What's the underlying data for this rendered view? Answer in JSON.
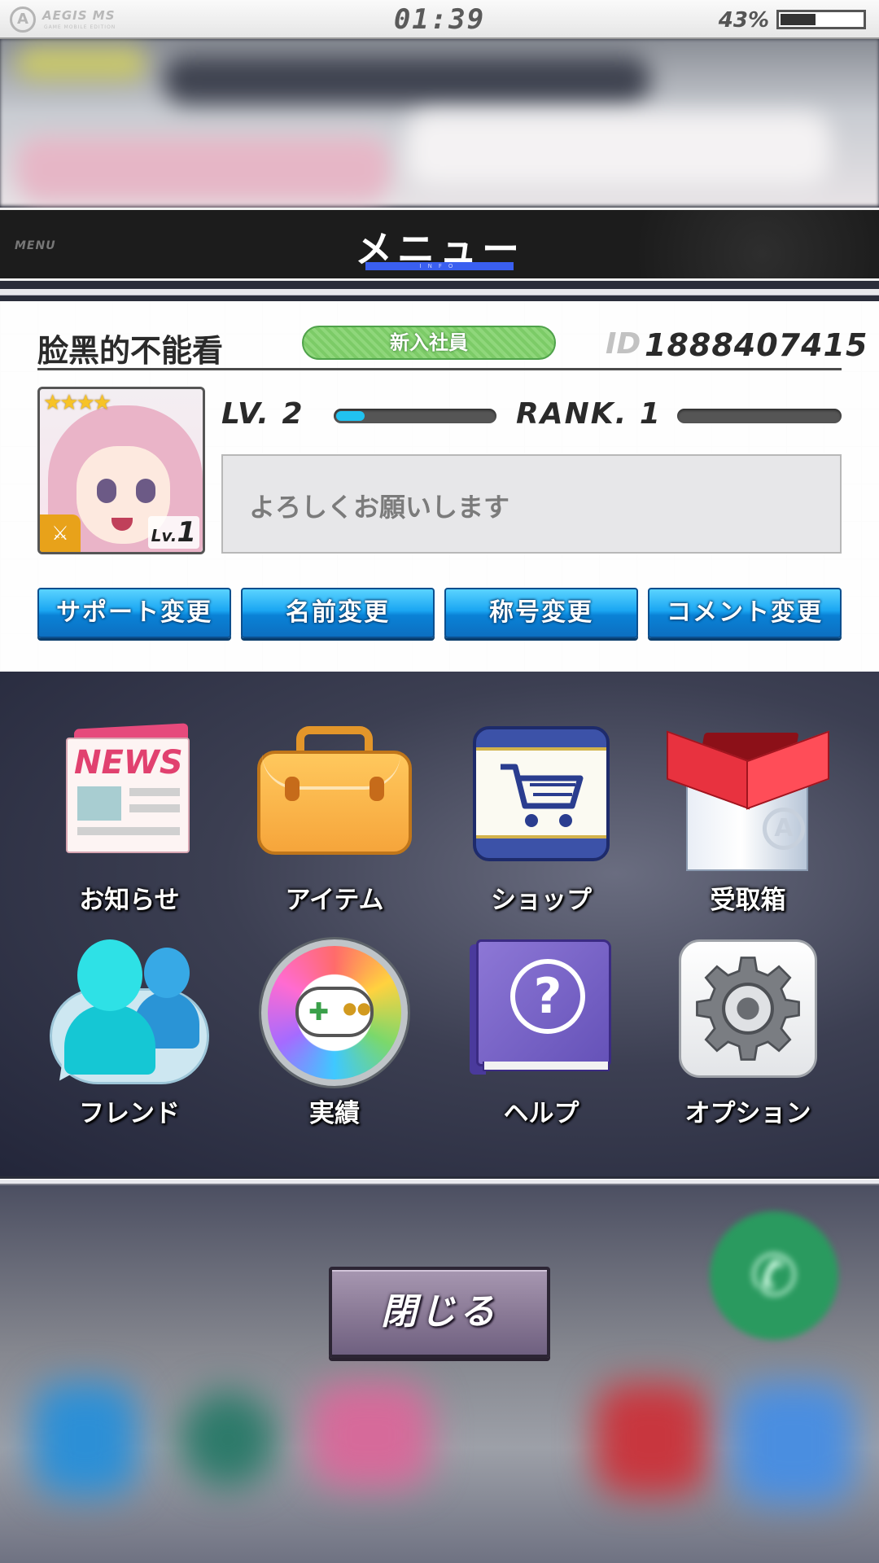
{
  "status_bar": {
    "brand": "AEGIS MS",
    "brand_sub": "GAME MOBILE EDITION",
    "time": "01:39",
    "battery": "43%",
    "battery_level": 0.43
  },
  "menu_header": {
    "small_label": "MENU",
    "title": "メニュー",
    "underline_label": "INFO"
  },
  "profile": {
    "player_name": "脸黑的不能看",
    "title_badge": "新入社員",
    "id_label": "ID",
    "id_value": "1888407415",
    "avatar": {
      "stars": "★★★★",
      "level_label": "Lv.",
      "level": "1"
    },
    "lv_text": "LV. 2",
    "lv_progress": 0.18,
    "rank_text": "RANK. 1",
    "rank_progress": 0.0,
    "comment": "よろしくお願いします",
    "buttons": {
      "support": "サポート変更",
      "name": "名前変更",
      "title": "称号変更",
      "comment": "コメント変更"
    }
  },
  "grid": {
    "news": {
      "label": "お知らせ",
      "headline": "NEWS",
      "icon": "newspaper-icon"
    },
    "items": {
      "label": "アイテム",
      "icon": "briefcase-icon"
    },
    "shop": {
      "label": "ショップ",
      "icon": "cart-icon"
    },
    "giftbox": {
      "label": "受取箱",
      "icon": "gift-box-icon"
    },
    "friend": {
      "label": "フレンド",
      "icon": "friends-icon"
    },
    "achievements": {
      "label": "実績",
      "icon": "gamepad-icon"
    },
    "help": {
      "label": "ヘルプ",
      "icon": "help-book-icon"
    },
    "options": {
      "label": "オプション",
      "icon": "gear-icon"
    }
  },
  "close_button": {
    "label": "閉じる"
  },
  "colors": {
    "accent_blue": "#1aa6f2",
    "badge_green": "#8fd77b",
    "header_bg": "#1c1c1c",
    "menu_underline": "#3a5ff0",
    "close_button": "#8b7b97"
  }
}
